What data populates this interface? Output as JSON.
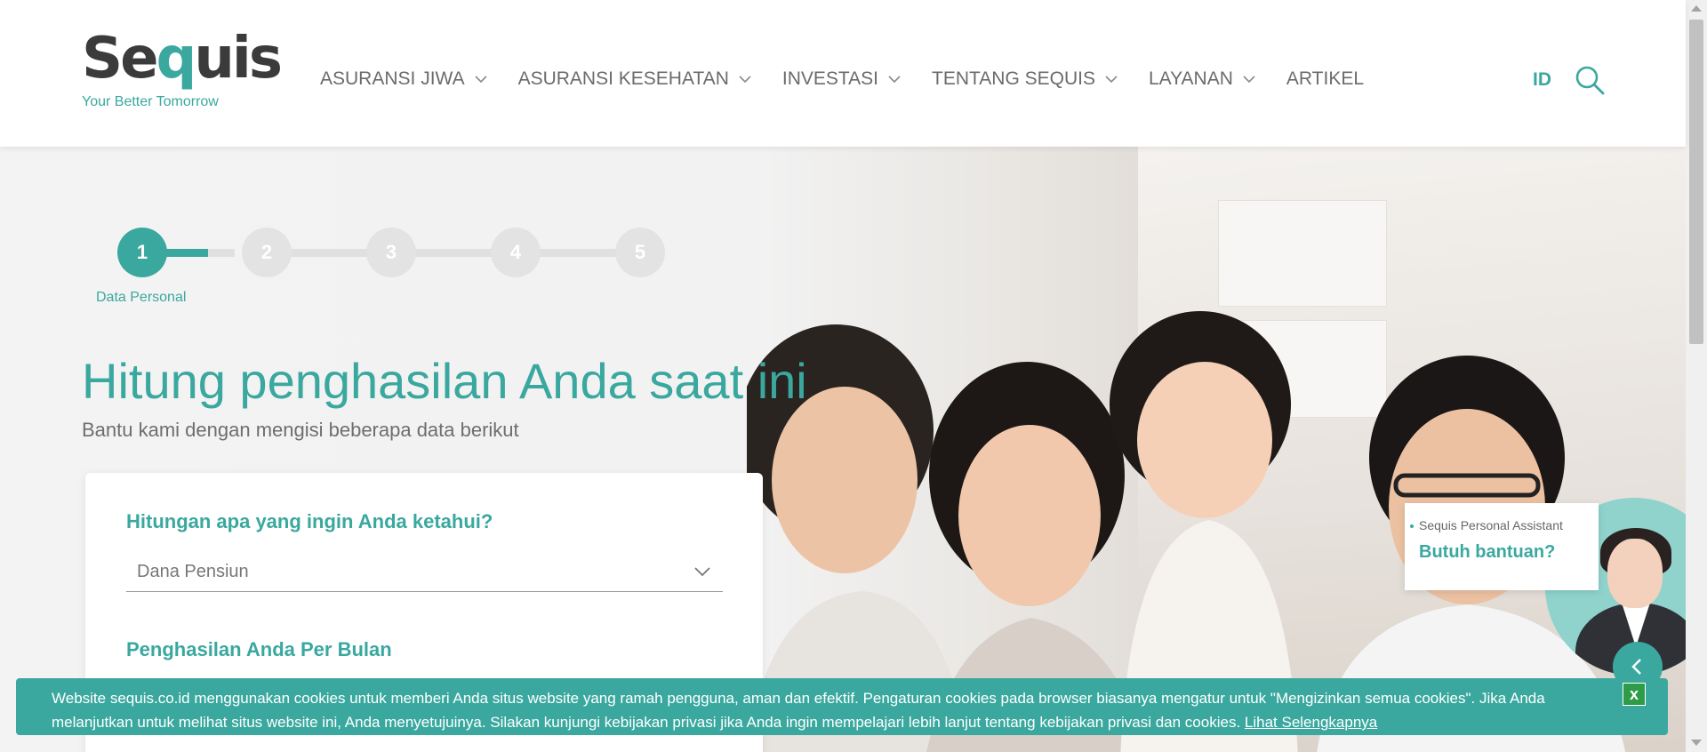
{
  "header": {
    "logo_text": "Sequis",
    "tagline": "Your Better Tomorrow",
    "nav": [
      {
        "label": "ASURANSI JIWA",
        "dropdown": true
      },
      {
        "label": "ASURANSI KESEHATAN",
        "dropdown": true
      },
      {
        "label": "INVESTASI",
        "dropdown": true
      },
      {
        "label": "TENTANG SEQUIS",
        "dropdown": true
      },
      {
        "label": "LAYANAN",
        "dropdown": true
      },
      {
        "label": "ARTIKEL",
        "dropdown": false
      }
    ],
    "language": "ID",
    "search_icon": "search-icon"
  },
  "stepper": {
    "steps": [
      "1",
      "2",
      "3",
      "4",
      "5"
    ],
    "active_step": 1,
    "active_label": "Data Personal"
  },
  "hero": {
    "title": "Hitung penghasilan Anda saat ini",
    "subtitle": "Bantu kami dengan mengisi beberapa data berikut"
  },
  "form": {
    "question_1": "Hitungan apa yang ingin Anda ketahui?",
    "calc_type_value": "Dana Pensiun",
    "question_2": "Penghasilan Anda Per Bulan"
  },
  "assistant": {
    "label": "Sequis Personal Assistant",
    "help_text": "Butuh bantuan?"
  },
  "cookie": {
    "text": "Website sequis.co.id menggunakan cookies untuk memberi Anda situs website yang ramah pengguna, aman dan efektif. Pengaturan cookies pada browser biasanya mengatur untuk \"Mengizinkan semua cookies\". Jika Anda melanjutkan untuk melihat situs website ini, Anda menyetujuinya. Silakan kunjungi kebijakan privasi jika Anda ingin mempelajari lebih lanjut tentang kebijakan privasi dan cookies. ",
    "link_text": "Lihat Selengkapnya",
    "close_label": "x"
  },
  "colors": {
    "brand_teal": "#3aa89f",
    "logo_dark": "#3b3b3b",
    "cookie_close_green": "#2e9b48"
  }
}
